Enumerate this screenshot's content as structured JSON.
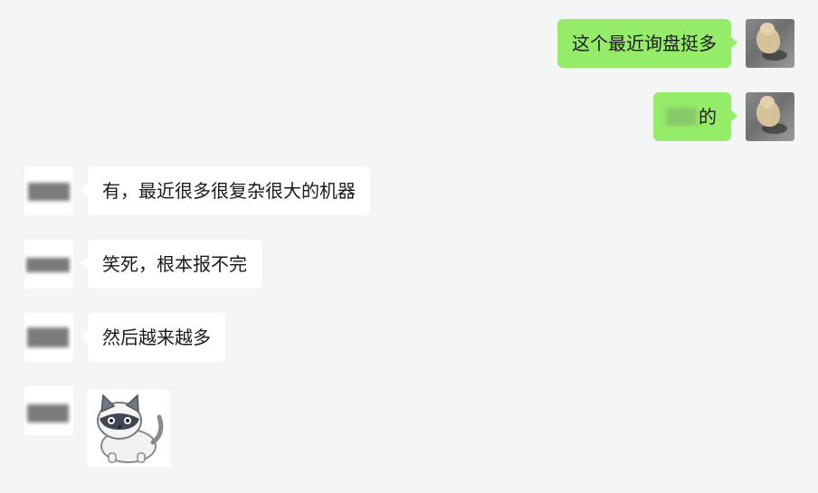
{
  "messages": [
    {
      "side": "self",
      "text": "这个最近询盘挺多"
    },
    {
      "side": "self",
      "text": "的",
      "censored_prefix": true
    },
    {
      "side": "other",
      "text": "有，最近很多很复杂很大的机器"
    },
    {
      "side": "other",
      "text": "笑死，根本报不完"
    },
    {
      "side": "other",
      "text": "然后越来越多"
    },
    {
      "side": "other",
      "type": "sticker",
      "sticker": "raccoon-cat-sticker"
    }
  ],
  "colors": {
    "background": "#f4f5f5",
    "self_bubble": "#95ec69",
    "other_bubble": "#ffffff",
    "text": "#1a1a1a"
  },
  "icons": {
    "self_avatar": "dog-photo-avatar",
    "other_avatar": "blurred-avatar"
  }
}
